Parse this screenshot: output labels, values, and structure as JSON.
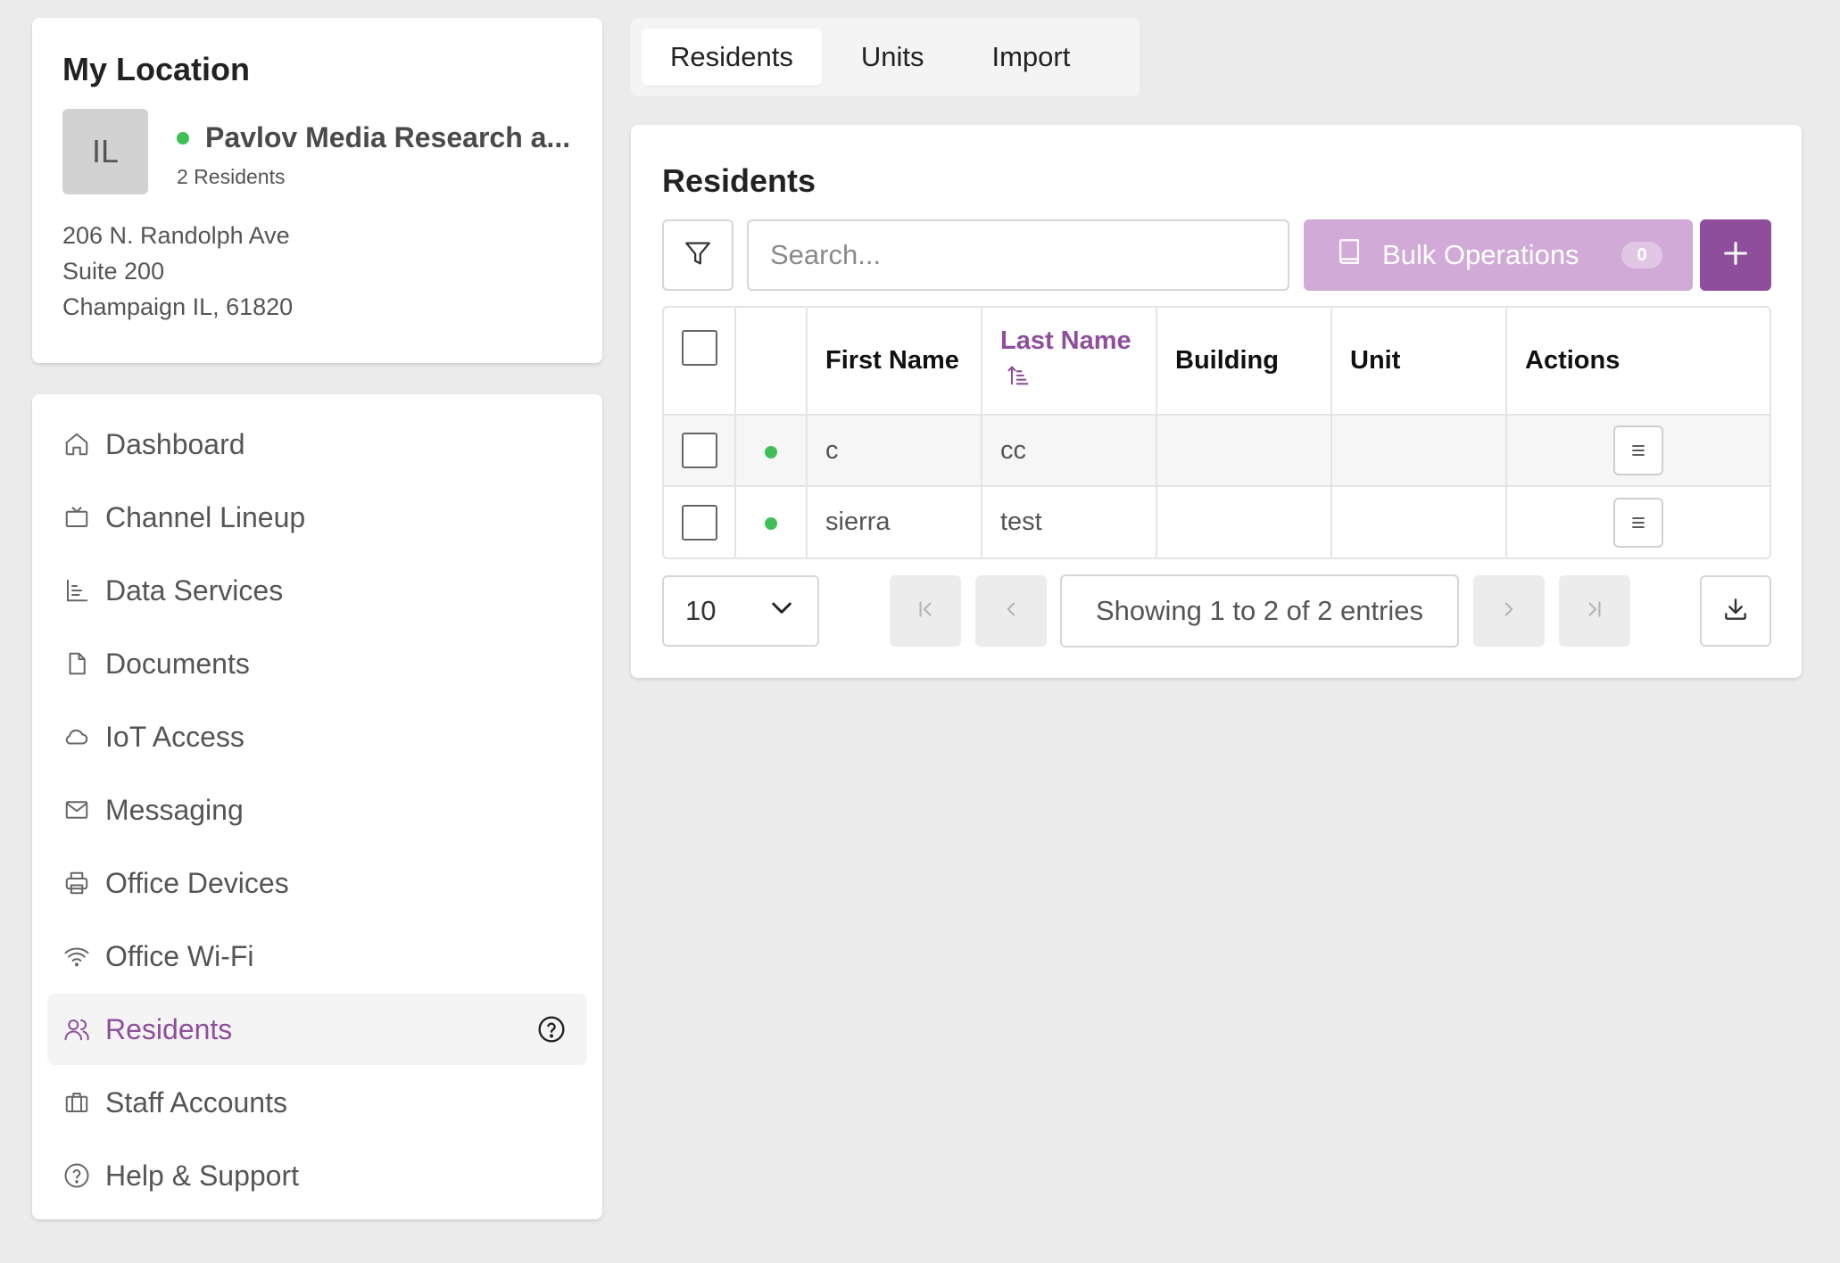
{
  "location": {
    "title": "My Location",
    "avatar_initials": "IL",
    "name": "Pavlov Media Research a...",
    "residents_count": "2 Residents",
    "address_line1": "206 N. Randolph Ave",
    "address_line2": "Suite 200",
    "address_line3": "Champaign IL, 61820",
    "status_color": "#3fbf57"
  },
  "sidebar": {
    "items": [
      {
        "label": "Dashboard",
        "icon": "home-icon"
      },
      {
        "label": "Channel Lineup",
        "icon": "tv-icon"
      },
      {
        "label": "Data Services",
        "icon": "bar-chart-icon"
      },
      {
        "label": "Documents",
        "icon": "document-icon"
      },
      {
        "label": "IoT Access",
        "icon": "cloud-icon"
      },
      {
        "label": "Messaging",
        "icon": "mail-icon"
      },
      {
        "label": "Office Devices",
        "icon": "printer-icon"
      },
      {
        "label": "Office Wi-Fi",
        "icon": "wifi-icon"
      },
      {
        "label": "Residents",
        "icon": "users-icon",
        "active": true
      },
      {
        "label": "Staff Accounts",
        "icon": "briefcase-icon"
      },
      {
        "label": "Help & Support",
        "icon": "help-circle-icon"
      }
    ]
  },
  "tabs": [
    "Residents",
    "Units",
    "Import"
  ],
  "main": {
    "title": "Residents",
    "search_placeholder": "Search...",
    "bulk_label": "Bulk Operations",
    "bulk_count": "0",
    "columns": [
      "First Name",
      "Last Name",
      "Building",
      "Unit",
      "Actions"
    ],
    "rows": [
      {
        "first": "c",
        "last": "cc",
        "building": "",
        "unit": ""
      },
      {
        "first": "sierra",
        "last": "test",
        "building": "",
        "unit": ""
      }
    ],
    "page_size": "10",
    "pagination_info": "Showing 1 to 2 of 2 entries"
  },
  "colors": {
    "accent": "#8e4e9c",
    "accent_light": "#d1aad8",
    "status_green": "#3fbf57"
  }
}
